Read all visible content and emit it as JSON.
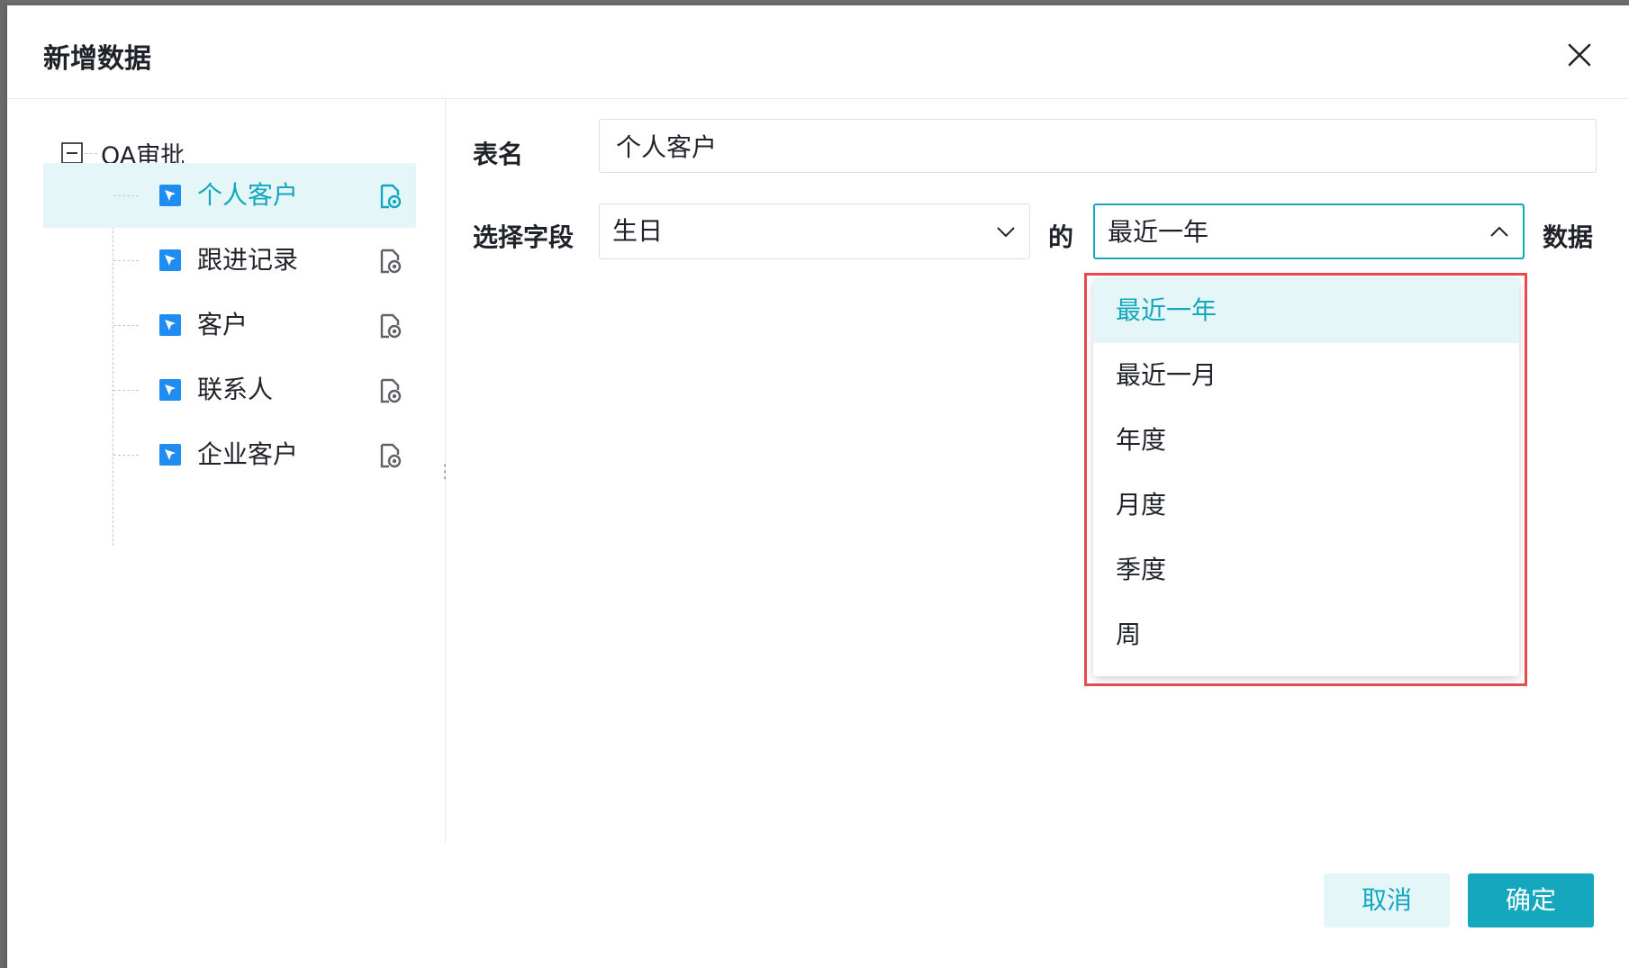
{
  "dialog": {
    "title": "新增数据"
  },
  "tree": {
    "root": {
      "label": "OA审批",
      "expanded": true
    },
    "items": [
      {
        "label": "个人客户",
        "selected": true
      },
      {
        "label": "跟进记录",
        "selected": false
      },
      {
        "label": "客户",
        "selected": false
      },
      {
        "label": "联系人",
        "selected": false
      },
      {
        "label": "企业客户",
        "selected": false
      }
    ]
  },
  "form": {
    "table_name_label": "表名",
    "table_name_value": "个人客户",
    "field_label": "选择字段",
    "field_value": "生日",
    "connector": "的",
    "range_value": "最近一年",
    "suffix": "数据"
  },
  "dropdown": {
    "options": [
      "最近一年",
      "最近一月",
      "年度",
      "月度",
      "季度",
      "周"
    ],
    "selected": "最近一年"
  },
  "buttons": {
    "cancel": "取消",
    "ok": "确定"
  },
  "colors": {
    "accent": "#14a7bd",
    "selected_bg": "#e4f6f8",
    "highlight_border": "#e84a4f",
    "table_icon": "#1e8cf0"
  }
}
